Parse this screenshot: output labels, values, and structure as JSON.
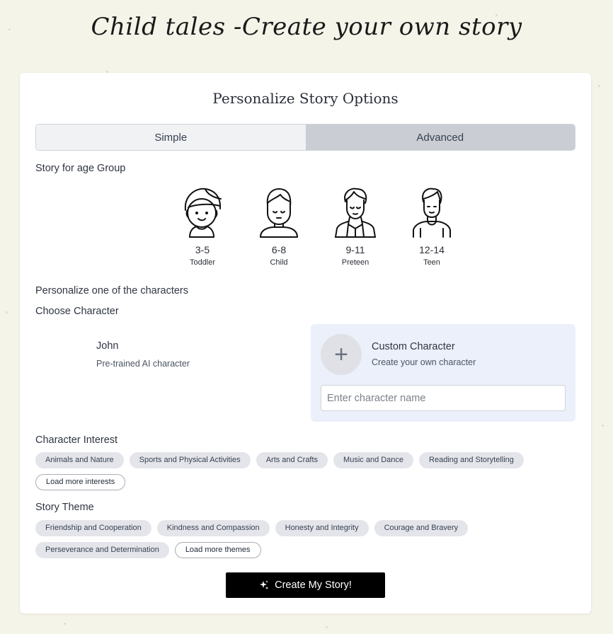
{
  "site_title": "Child tales -Create your own story",
  "card_title": "Personalize Story Options",
  "tabs": [
    {
      "label": "Simple"
    },
    {
      "label": "Advanced"
    }
  ],
  "age_section_label": "Story for age Group",
  "age_groups": [
    {
      "range": "3-5",
      "name": "Toddler",
      "icon": "toddler-icon"
    },
    {
      "range": "6-8",
      "name": "Child",
      "icon": "child-icon"
    },
    {
      "range": "9-11",
      "name": "Preteen",
      "icon": "preteen-icon"
    },
    {
      "range": "12-14",
      "name": "Teen",
      "icon": "teen-icon"
    }
  ],
  "personalize_label": "Personalize one of the characters",
  "choose_character_label": "Choose Character",
  "pretrained_character": {
    "name": "John",
    "description": "Pre-trained AI character"
  },
  "custom_character": {
    "title": "Custom Character",
    "description": "Create your own character",
    "input_placeholder": "Enter character name",
    "input_value": "",
    "icon": "plus-icon"
  },
  "interest_label": "Character Interest",
  "interests": [
    "Animals and Nature",
    "Sports and Physical Activities",
    "Arts and Crafts",
    "Music and Dance",
    "Reading and Storytelling"
  ],
  "load_more_interests": "Load more interests",
  "theme_label": "Story Theme",
  "themes": [
    "Friendship and Cooperation",
    "Kindness and Compassion",
    "Honesty and Integrity",
    "Courage and Bravery",
    "Perseverance and Determination"
  ],
  "load_more_themes": "Load more themes",
  "create_button": {
    "label": "Create My Story!",
    "icon": "sparkle-icon"
  }
}
